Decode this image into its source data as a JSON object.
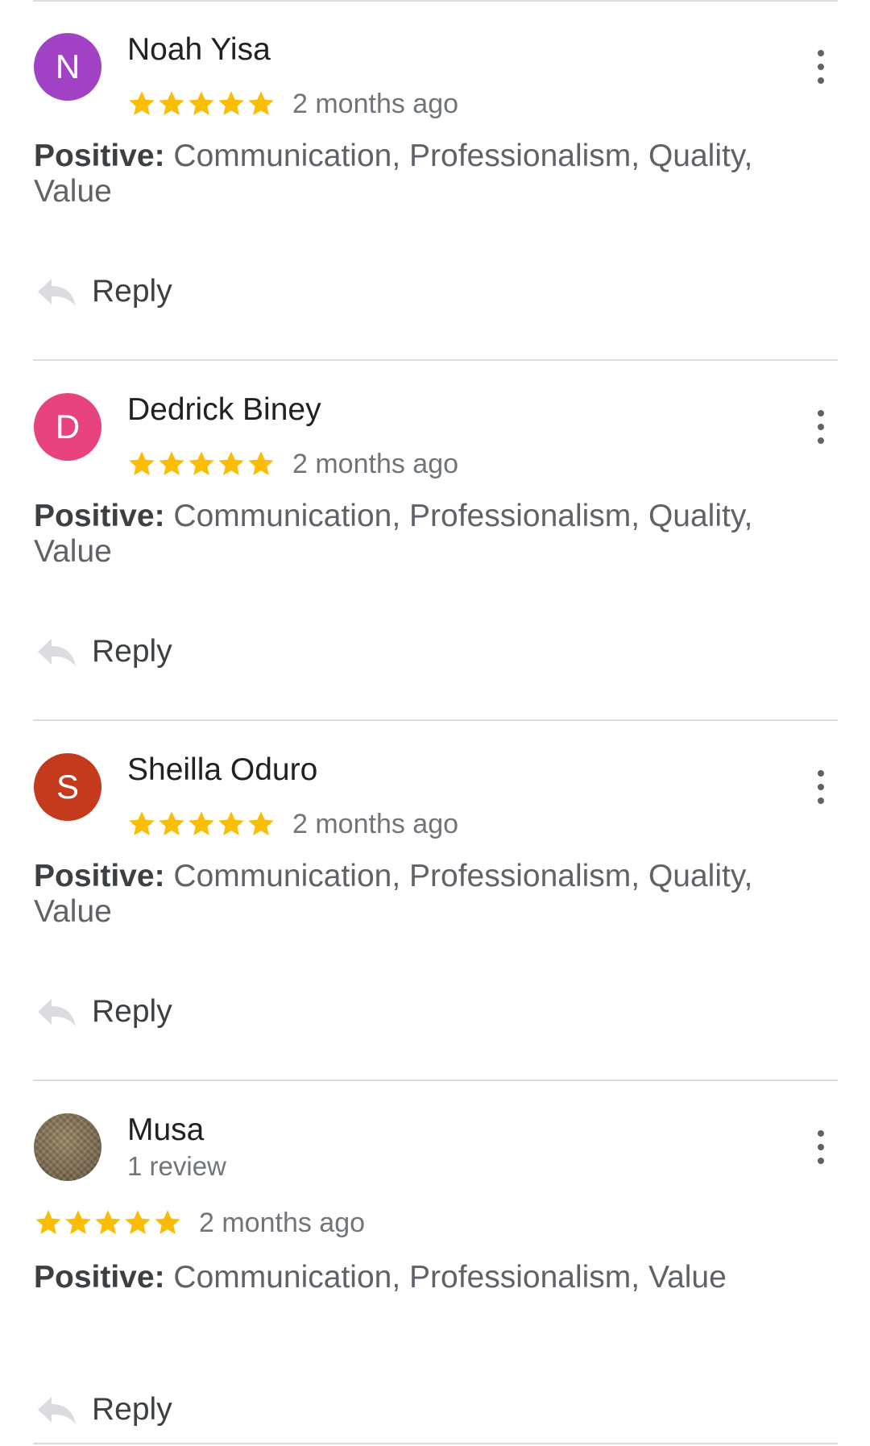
{
  "reviews": [
    {
      "initial": "N",
      "avatar_color": "#a142c4",
      "name": "Noah Yisa",
      "rating": 5,
      "date": "2 months ago",
      "positive_label": "Positive:",
      "positive_text": "Communication, Professionalism, Quality, Value",
      "reply_label": "Reply"
    },
    {
      "initial": "D",
      "avatar_color": "#e8427f",
      "name": "Dedrick Biney",
      "rating": 5,
      "date": "2 months ago",
      "positive_label": "Positive:",
      "positive_text": "Communication, Professionalism, Quality, Value",
      "reply_label": "Reply"
    },
    {
      "initial": "S",
      "avatar_color": "#c5391c",
      "name": "Sheilla Oduro",
      "rating": 5,
      "date": "2 months ago",
      "positive_label": "Positive:",
      "positive_text": "Communication, Professionalism, Quality, Value",
      "reply_label": "Reply"
    },
    {
      "name": "Musa",
      "review_count": "1 review",
      "rating": 5,
      "date": "2 months ago",
      "positive_label": "Positive:",
      "positive_text": "Communication, Professionalism, Value",
      "reply_label": "Reply"
    }
  ],
  "colors": {
    "star": "#fbbc04",
    "divider": "#dadce0",
    "secondary_text": "#70757a"
  },
  "icons": {
    "more": "more-vert-icon",
    "reply": "reply-arrow-icon",
    "star": "star-icon"
  }
}
